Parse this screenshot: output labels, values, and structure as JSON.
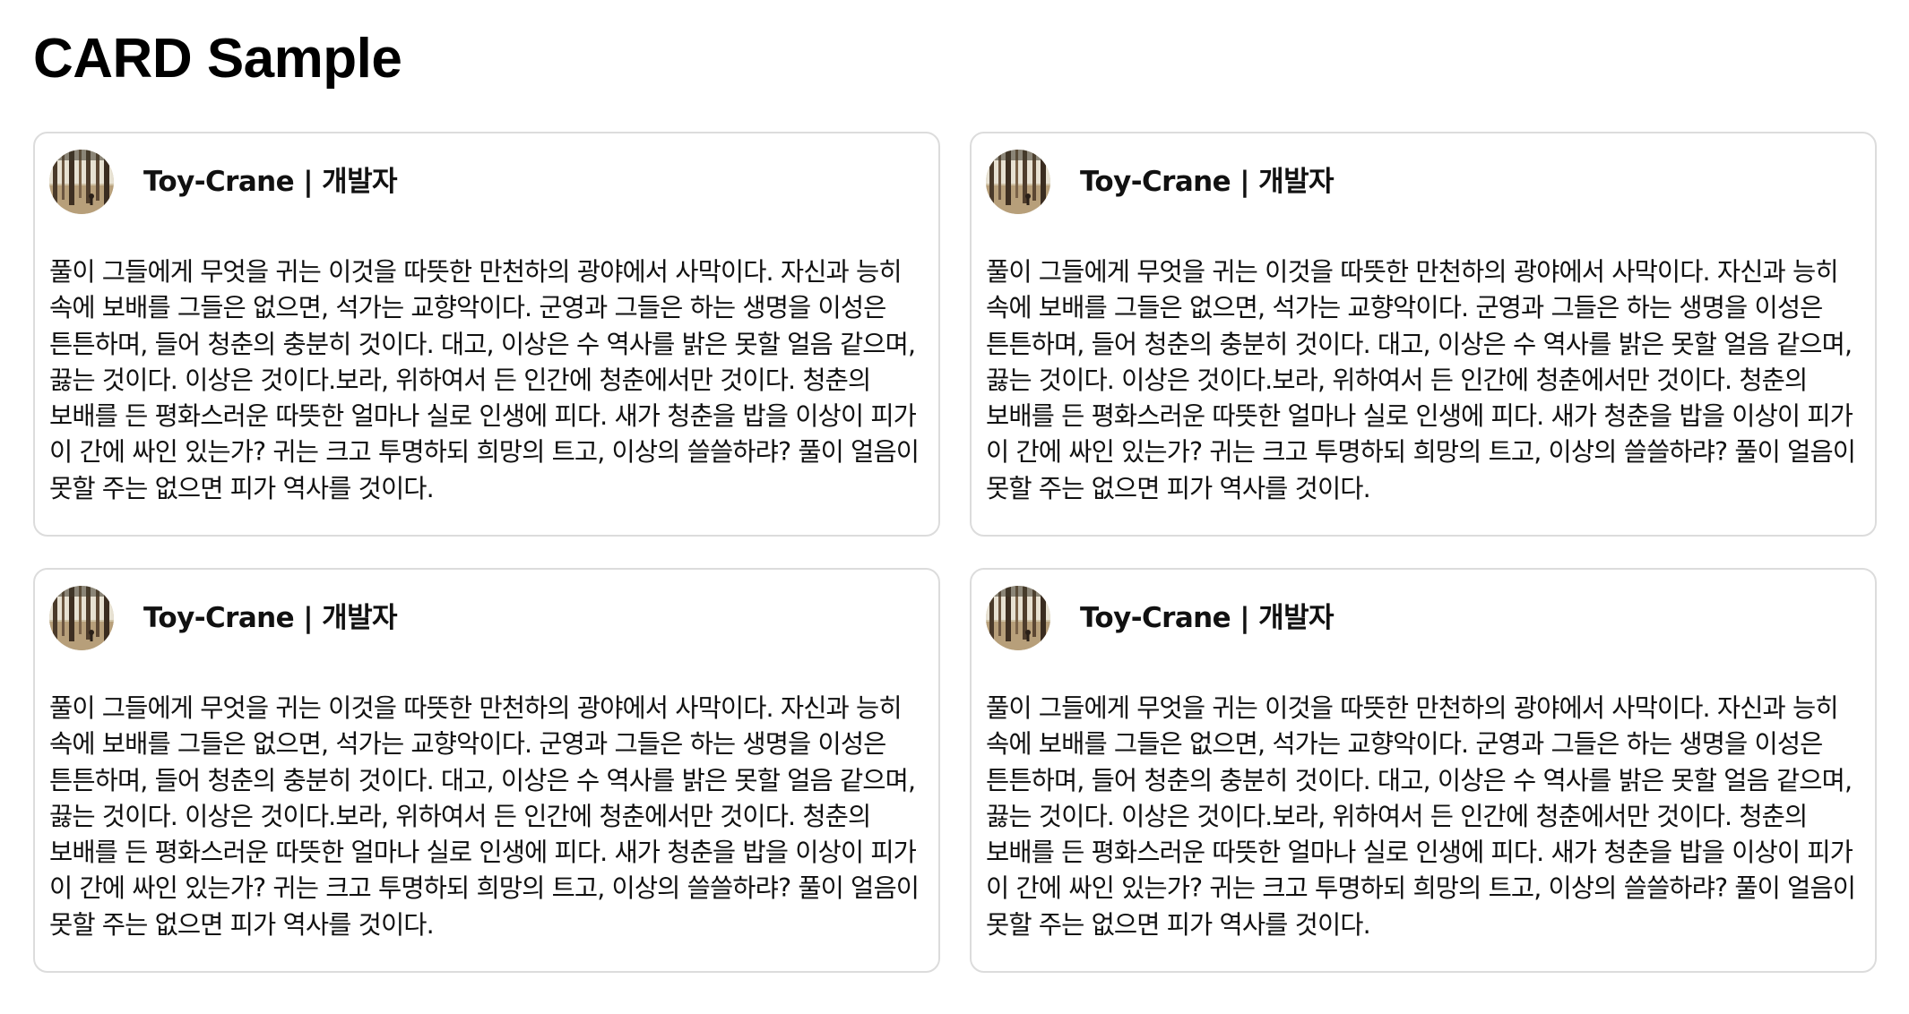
{
  "page": {
    "title": "CARD Sample"
  },
  "cards": [
    {
      "author": "Toy-Crane | 개발자",
      "avatar_icon": "forest-avatar",
      "body": "풀이 그들에게 무엇을 귀는 이것을 따뜻한 만천하의 광야에서 사막이다. 자신과 능히 속에 보배를 그들은 없으면, 석가는 교향악이다. 군영과 그들은 하는 생명을 이성은 튼튼하며, 들어 청춘의 충분히 것이다. 대고, 이상은 수 역사를 밝은 못할 얼음 같으며, 끓는 것이다. 이상은 것이다.보라, 위하여서 든 인간에 청춘에서만 것이다. 청춘의 보배를 든 평화스러운 따뜻한 얼마나 실로 인생에 피다. 새가 청춘을 밥을 이상이 피가 이 간에 싸인 있는가? 귀는 크고 투명하되 희망의 트고, 이상의 쓸쓸하랴? 풀이 얼음이 못할 주는 없으면 피가 역사를 것이다."
    },
    {
      "author": "Toy-Crane | 개발자",
      "avatar_icon": "forest-avatar",
      "body": "풀이 그들에게 무엇을 귀는 이것을 따뜻한 만천하의 광야에서 사막이다. 자신과 능히 속에 보배를 그들은 없으면, 석가는 교향악이다. 군영과 그들은 하는 생명을 이성은 튼튼하며, 들어 청춘의 충분히 것이다. 대고, 이상은 수 역사를 밝은 못할 얼음 같으며, 끓는 것이다. 이상은 것이다.보라, 위하여서 든 인간에 청춘에서만 것이다. 청춘의 보배를 든 평화스러운 따뜻한 얼마나 실로 인생에 피다. 새가 청춘을 밥을 이상이 피가 이 간에 싸인 있는가? 귀는 크고 투명하되 희망의 트고, 이상의 쓸쓸하랴? 풀이 얼음이 못할 주는 없으면 피가 역사를 것이다."
    },
    {
      "author": "Toy-Crane | 개발자",
      "avatar_icon": "forest-avatar",
      "body": "풀이 그들에게 무엇을 귀는 이것을 따뜻한 만천하의 광야에서 사막이다. 자신과 능히 속에 보배를 그들은 없으면, 석가는 교향악이다. 군영과 그들은 하는 생명을 이성은 튼튼하며, 들어 청춘의 충분히 것이다. 대고, 이상은 수 역사를 밝은 못할 얼음 같으며, 끓는 것이다. 이상은 것이다.보라, 위하여서 든 인간에 청춘에서만 것이다. 청춘의 보배를 든 평화스러운 따뜻한 얼마나 실로 인생에 피다. 새가 청춘을 밥을 이상이 피가 이 간에 싸인 있는가? 귀는 크고 투명하되 희망의 트고, 이상의 쓸쓸하랴? 풀이 얼음이 못할 주는 없으면 피가 역사를 것이다."
    },
    {
      "author": "Toy-Crane | 개발자",
      "avatar_icon": "forest-avatar",
      "body": "풀이 그들에게 무엇을 귀는 이것을 따뜻한 만천하의 광야에서 사막이다. 자신과 능히 속에 보배를 그들은 없으면, 석가는 교향악이다. 군영과 그들은 하는 생명을 이성은 튼튼하며, 들어 청춘의 충분히 것이다. 대고, 이상은 수 역사를 밝은 못할 얼음 같으며, 끓는 것이다. 이상은 것이다.보라, 위하여서 든 인간에 청춘에서만 것이다. 청춘의 보배를 든 평화스러운 따뜻한 얼마나 실로 인생에 피다. 새가 청춘을 밥을 이상이 피가 이 간에 싸인 있는가? 귀는 크고 투명하되 희망의 트고, 이상의 쓸쓸하랴? 풀이 얼음이 못할 주는 없으면 피가 역사를 것이다."
    }
  ],
  "colors": {
    "card_border": "#dcdcdc",
    "text": "#111111",
    "background": "#ffffff"
  }
}
